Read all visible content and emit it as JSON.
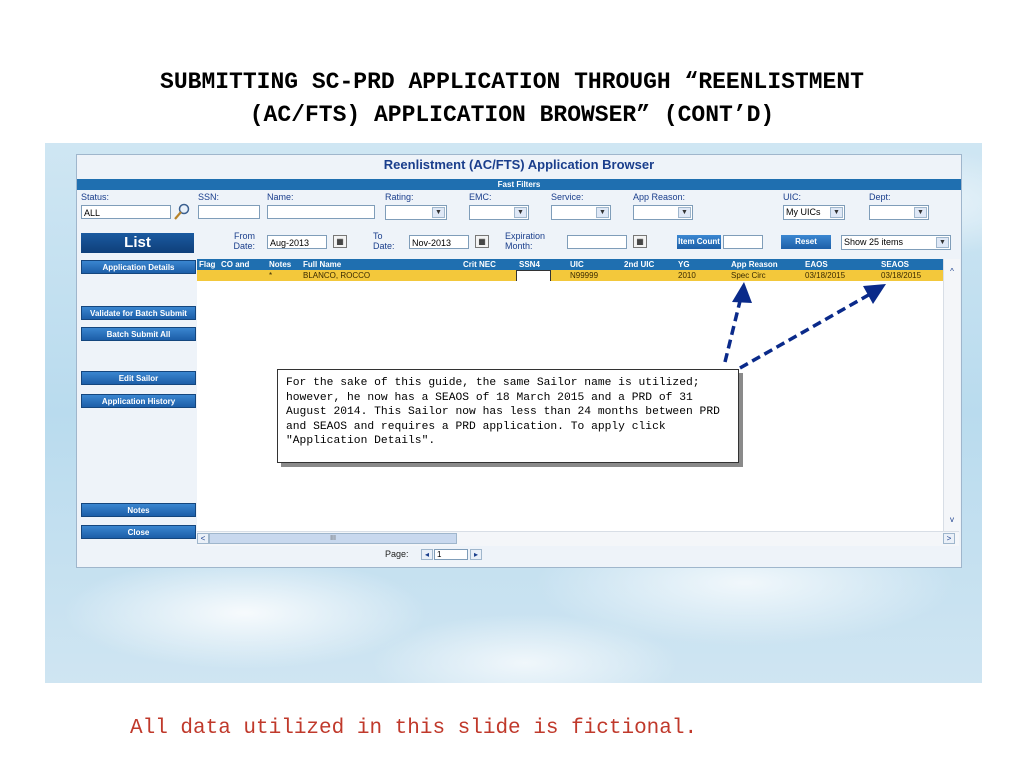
{
  "slide": {
    "title_line1": "SUBMITTING SC-PRD APPLICATION THROUGH “REENLISTMENT",
    "title_line2": "(AC/FTS) APPLICATION BROWSER” (CONT’D)",
    "footer": "All data utilized in this slide is fictional."
  },
  "app": {
    "title": "Reenlistment (AC/FTS) Application Browser",
    "fast_filters": "Fast Filters",
    "filters": {
      "status_label": "Status:",
      "status_value": "ALL",
      "ssn_label": "SSN:",
      "name_label": "Name:",
      "rating_label": "Rating:",
      "emc_label": "EMC:",
      "service_label": "Service:",
      "app_reason_label": "App Reason:",
      "uic_label": "UIC:",
      "uic_value": "My UICs",
      "dept_label": "Dept:",
      "from_label_1": "From",
      "from_label_2": "Date:",
      "from_value": "Aug-2013",
      "to_label_1": "To",
      "to_label_2": "Date:",
      "to_value": "Nov-2013",
      "exp_label_1": "Expiration",
      "exp_label_2": "Month:",
      "item_count": "Item Count",
      "reset": "Reset",
      "show_items": "Show 25 items"
    },
    "list_tab": "List",
    "side_buttons": {
      "application_details": "Application Details",
      "validate": "Validate for Batch Submit",
      "batch_submit": "Batch Submit All",
      "edit_sailor": "Edit Sailor",
      "app_history": "Application History",
      "notes": "Notes",
      "close": "Close"
    },
    "columns": [
      "Flag",
      "CO and",
      "Notes",
      "Full Name",
      "Crit NEC",
      "SSN4",
      "UIC",
      "2nd UIC",
      "YG",
      "App Reason",
      "EAOS",
      "SEAOS"
    ],
    "row": {
      "notes": "*",
      "full_name": "BLANCO, ROCCO",
      "uic": "N99999",
      "yg": "2010",
      "app_reason": "Spec Circ",
      "eaos": "03/18/2015",
      "seaos": "03/18/2015"
    },
    "pager": {
      "label": "Page:",
      "value": "1"
    },
    "callout": "For the sake of this guide, the same Sailor name is utilized; however, he now has a SEAOS of 18 March 2015 and a PRD of 31 August 2014.  This Sailor now has less than 24 months between PRD and SEAOS and requires a PRD application.  To apply click \"Application Details\"."
  }
}
